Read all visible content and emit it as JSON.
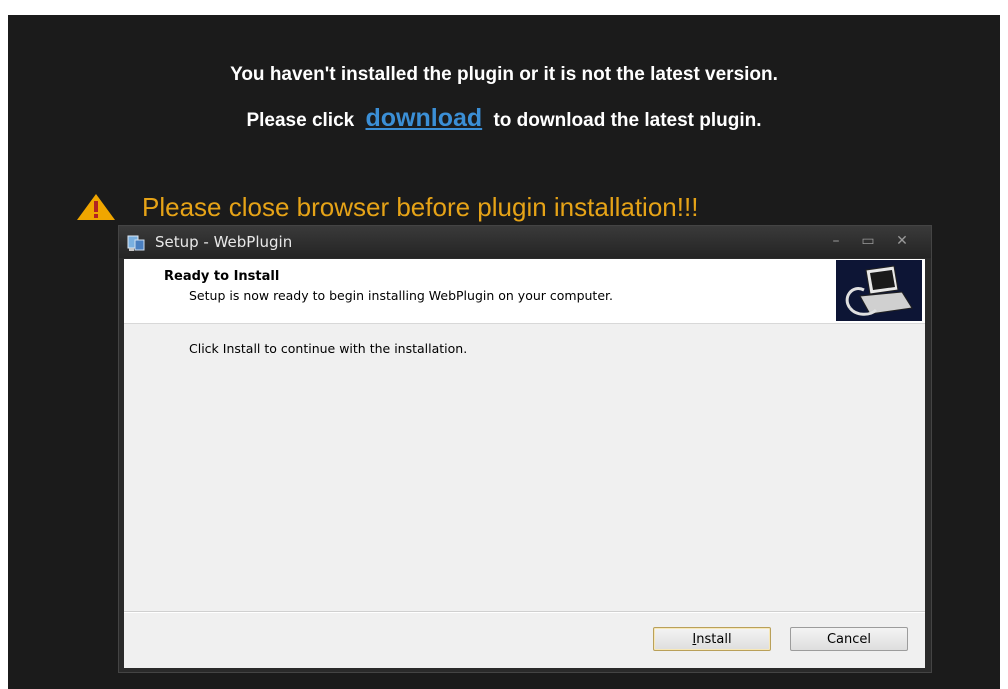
{
  "page": {
    "line1": "You haven't installed the plugin or it is not the latest version.",
    "line2_prefix": "Please click",
    "download_link": "download",
    "line2_suffix": "to download the latest plugin.",
    "warning": "Please close browser before plugin installation!!!"
  },
  "dialog": {
    "title": "Setup - WebPlugin",
    "controls": {
      "minimize": "–",
      "maximize": "▭",
      "close": "✕"
    },
    "header_title": "Ready to Install",
    "header_subtitle": "Setup is now ready to begin installing WebPlugin on your computer.",
    "body": "Click Install to continue with the installation.",
    "install_first": "I",
    "install_rest": "nstall",
    "cancel": "Cancel"
  },
  "colors": {
    "background": "#1b1b1b",
    "link": "#3b8fd6",
    "warning_text": "#e6a317",
    "warning_icon": "#f0a600"
  },
  "icons": {
    "warning": "warning-triangle-icon",
    "setup": "setup-app-icon",
    "installer": "installer-computer-icon"
  }
}
